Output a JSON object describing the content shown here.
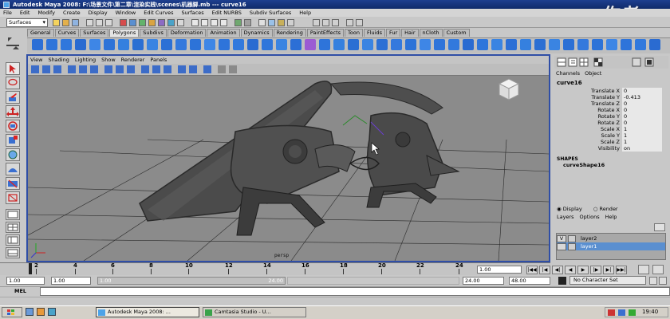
{
  "window": {
    "title": "Autodesk Maya 2008: F:\\场景文件\\第二章\\渲染实践\\scenes\\机器脚.mb  ---  curve16",
    "watermark": "作者"
  },
  "menubar": [
    "File",
    "Edit",
    "Modify",
    "Create",
    "Display",
    "Window",
    "Edit Curves",
    "Surfaces",
    "Edit NURBS",
    "Subdiv Surfaces",
    "Help"
  ],
  "statusline": {
    "mode": "Surfaces"
  },
  "shelf": {
    "tabs": [
      "General",
      "Curves",
      "Surfaces",
      "Polygons",
      "Subdivs",
      "Deformation",
      "Animation",
      "Dynamics",
      "Rendering",
      "PaintEffects",
      "Toon",
      "Fluids",
      "Fur",
      "Hair",
      "nCloth",
      "Custom"
    ],
    "active_tab": "Polygons"
  },
  "panel": {
    "menu": [
      "View",
      "Shading",
      "Lighting",
      "Show",
      "Renderer",
      "Panels"
    ],
    "camera_label": "persp"
  },
  "channel_box": {
    "header": [
      "Channels",
      "Object"
    ],
    "object": "curve16",
    "attributes": [
      {
        "name": "Translate X",
        "value": "0"
      },
      {
        "name": "Translate Y",
        "value": "-0.413"
      },
      {
        "name": "Translate Z",
        "value": "0"
      },
      {
        "name": "Rotate X",
        "value": "0"
      },
      {
        "name": "Rotate Y",
        "value": "0"
      },
      {
        "name": "Rotate Z",
        "value": "0"
      },
      {
        "name": "Scale X",
        "value": "1"
      },
      {
        "name": "Scale Y",
        "value": "1"
      },
      {
        "name": "Scale Z",
        "value": "1"
      },
      {
        "name": "Visibility",
        "value": "on"
      }
    ],
    "shapes_title": "SHAPES",
    "shape_name": "curveShape16"
  },
  "layers": {
    "radio": [
      "Display",
      "Render"
    ],
    "menu": [
      "Layers",
      "Options",
      "Help"
    ],
    "items": [
      {
        "visible": "V",
        "name": "layer2",
        "selected": false
      },
      {
        "visible": "",
        "name": "layer1",
        "selected": true
      }
    ]
  },
  "timeslider": {
    "ticks": [
      "2",
      "4",
      "6",
      "8",
      "10",
      "12",
      "14",
      "16",
      "18",
      "20",
      "22",
      "24"
    ],
    "current_frame": "1.00"
  },
  "rangeslider": {
    "start": "1.00",
    "anim_start": "1.00",
    "range_left": "1.00",
    "range_right": "24.00",
    "end": "24.00",
    "anim_end": "48.00",
    "character_set": "No Character Set"
  },
  "cmdline": {
    "label": "MEL"
  },
  "taskbar": {
    "tasks": [
      "Autodesk Maya 2008: ...",
      "Camtasia Studio - U..."
    ],
    "clock": "19:40"
  }
}
